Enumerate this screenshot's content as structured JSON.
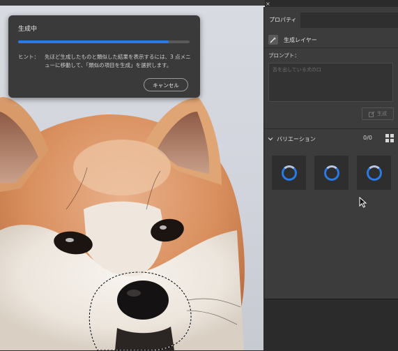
{
  "dialog": {
    "title": "生成中",
    "progress_percent": 88,
    "hint_label": "ヒント：",
    "hint_text": "先ほど生成したものと類似した結果を表示するには、3 点メニューに移動して、「類似の項目を生成」を選択します。",
    "cancel_label": "キャンセル"
  },
  "panel": {
    "close_glyph": "×",
    "tab_label": "プロパティ",
    "layer_label": "生成レイヤー",
    "prompt_label": "プロンプト：",
    "prompt_placeholder": "舌を出している犬の口",
    "generate_label": "生成",
    "variations_label": "バリエーション",
    "variations_count": "0/0"
  },
  "colors": {
    "accent": "#2a7ae9",
    "panel_bg": "#3c3c3c",
    "dialog_bg": "#3a3a3a"
  },
  "icons": [
    "close-icon",
    "generative-layer-icon",
    "generate-icon",
    "chevron-down-icon",
    "grid-view-icon",
    "loading-spinner-icon",
    "mouse-pointer-icon"
  ]
}
